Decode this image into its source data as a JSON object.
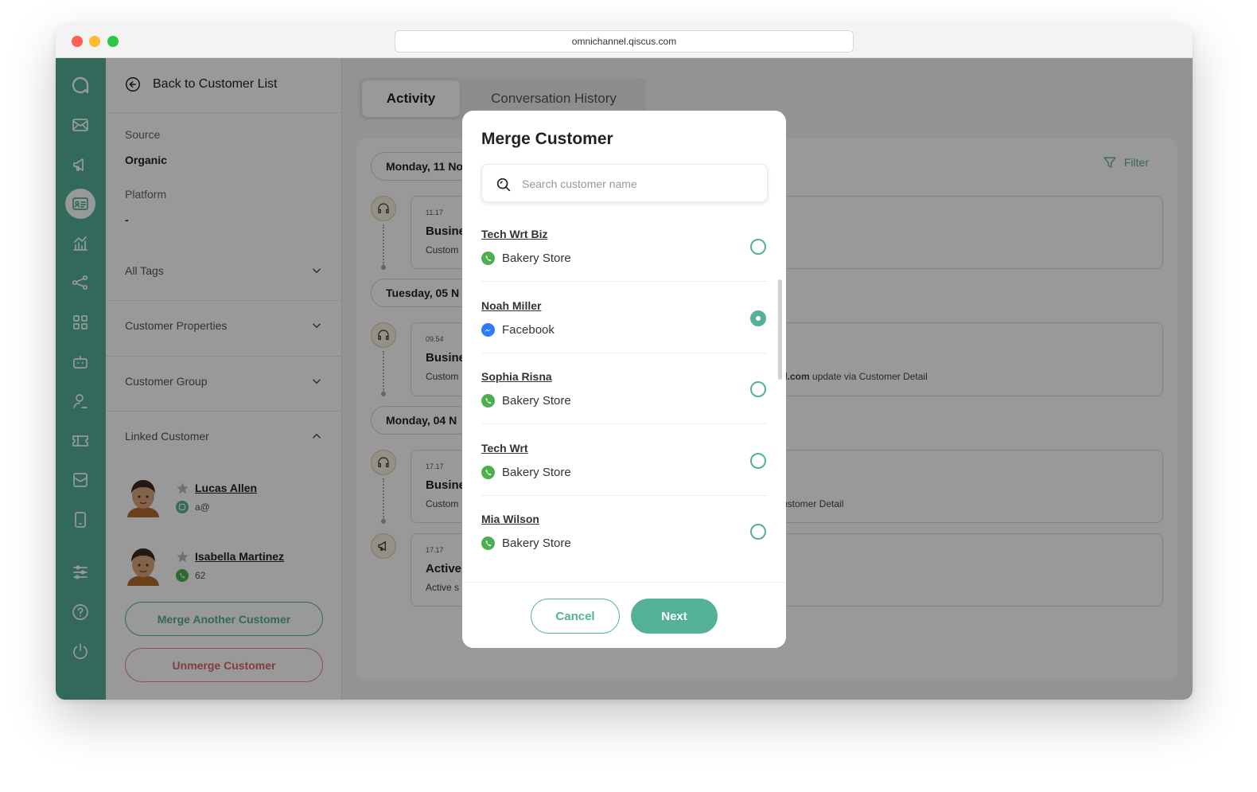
{
  "browser": {
    "url": "omnichannel.qiscus.com"
  },
  "colors": {
    "brand": "#54b096",
    "danger": "#e06565",
    "whatsapp": "#4caf50",
    "facebook": "#2f7cf6"
  },
  "rail": {
    "icons": [
      "logo-icon",
      "inbox-icon",
      "broadcast-icon",
      "customer-icon",
      "analytics-icon",
      "integration-icon",
      "apps-icon",
      "bot-icon",
      "agent-icon",
      "ticket-icon",
      "mailbox-icon",
      "mobile-icon",
      "settings-icon",
      "help-icon",
      "logout-icon"
    ],
    "active": "customer-icon"
  },
  "left_panel": {
    "back_label": "Back to Customer List",
    "source_label": "Source",
    "source_value": "Organic",
    "platform_label": "Platform",
    "platform_value": "-",
    "sections": {
      "all_tags": "All Tags",
      "customer_properties": "Customer Properties",
      "customer_group": "Customer Group",
      "linked_customer": "Linked Customer"
    },
    "linked": [
      {
        "name": "Lucas Allen",
        "sub": "a@",
        "channel": "email"
      },
      {
        "name": "Isabella Martinez",
        "sub": "62",
        "channel": "whatsapp"
      }
    ],
    "merge_label": "Merge Another Customer",
    "unmerge_label": "Unmerge Customer"
  },
  "main": {
    "tabs": [
      {
        "label": "Activity"
      },
      {
        "label": "Conversation History"
      }
    ],
    "filter_label": "Filter",
    "dates": [
      "Monday, 11 No",
      "Tuesday, 05 N",
      "Monday, 04 N"
    ],
    "cards": [
      {
        "time": "11.17",
        "title": "Busine",
        "desc": "Custom",
        "right_bold": "",
        "right_text": ""
      },
      {
        "time": "09.54",
        "title": "Busine",
        "desc": "Custom",
        "right_bold": "il.com",
        "right_text": " update via Customer Detail"
      },
      {
        "time": "17.17",
        "title": "Busine",
        "desc": "Custom",
        "right_bold": "",
        "right_text": "ustomer Detail"
      },
      {
        "time": "17.17",
        "title": "Active",
        "desc": "Active s",
        "right_bold": "",
        "right_text": ""
      }
    ]
  },
  "modal": {
    "title": "Merge Customer",
    "search_placeholder": "Search customer name",
    "customers": [
      {
        "name": "Tech Wrt Biz",
        "channel": "Bakery Store",
        "channel_type": "whatsapp",
        "selected": false
      },
      {
        "name": "Noah Miller",
        "channel": "Facebook",
        "channel_type": "facebook",
        "selected": true
      },
      {
        "name": "Sophia Risna",
        "channel": "Bakery Store",
        "channel_type": "whatsapp",
        "selected": false
      },
      {
        "name": "Tech Wrt",
        "channel": "Bakery Store",
        "channel_type": "whatsapp",
        "selected": false
      },
      {
        "name": "Mia Wilson",
        "channel": "Bakery Store",
        "channel_type": "whatsapp",
        "selected": false
      }
    ],
    "cancel_label": "Cancel",
    "next_label": "Next"
  }
}
